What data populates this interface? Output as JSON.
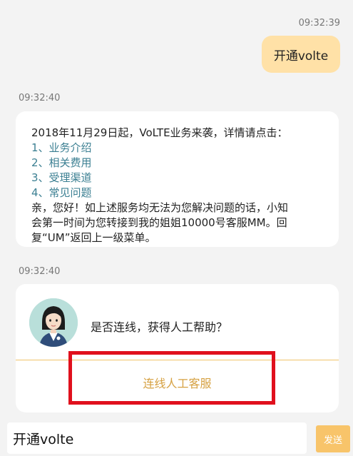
{
  "chat": {
    "time_user": "09:32:39",
    "user_message": "开通volte",
    "time_bot": "09:32:40",
    "bot_message": {
      "intro": "2018年11月29日起，VoLTE业务来袭，详情请点击：",
      "links": [
        "1、业务介绍",
        "2、相关费用",
        "3、受理渠道",
        "4、常见问题"
      ],
      "outro_line1": "亲，您好！如上述服务均无法为您解决问题的话，小知",
      "outro_line2": "会第一时间为您转接到我的姐姐10000号客服MM。回",
      "outro_line3": "复“UM”返回上一级菜单。"
    },
    "time_assist": "09:32:40",
    "assist_question": "是否连线，获得人工帮助？",
    "connect_label": "连线人工客服"
  },
  "input_bar": {
    "value": "开通volte",
    "send_label": "发送"
  },
  "colors": {
    "user_bubble": "#ffe1a7",
    "link": "#3b7f92",
    "connect_text": "#d6a142",
    "send_button": "#f8c46a",
    "highlight_frame": "#e0101d"
  }
}
